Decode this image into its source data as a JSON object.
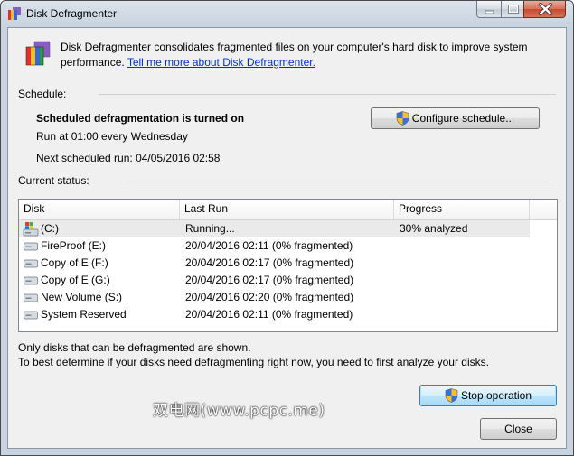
{
  "window": {
    "title": "Disk Defragmenter"
  },
  "intro": {
    "text": "Disk Defragmenter consolidates fragmented files on your computer's hard disk to improve system performance.",
    "link": "Tell me more about Disk Defragmenter."
  },
  "schedule": {
    "label": "Schedule:",
    "status": "Scheduled defragmentation is turned on",
    "run_at": "Run at 01:00 every Wednesday",
    "next_run": "Next scheduled run: 04/05/2016 02:58",
    "configure_button": "Configure schedule..."
  },
  "current_status": {
    "label": "Current status:",
    "columns": [
      "Disk",
      "Last Run",
      "Progress"
    ],
    "rows": [
      {
        "disk": "(C:)",
        "last_run": "Running...",
        "progress": "30% analyzed",
        "icon": "system-drive-icon"
      },
      {
        "disk": "FireProof (E:)",
        "last_run": "20/04/2016 02:11 (0% fragmented)",
        "progress": "",
        "icon": "drive-icon"
      },
      {
        "disk": "Copy of E (F:)",
        "last_run": "20/04/2016 02:17 (0% fragmented)",
        "progress": "",
        "icon": "drive-icon"
      },
      {
        "disk": "Copy of E (G:)",
        "last_run": "20/04/2016 02:17 (0% fragmented)",
        "progress": "",
        "icon": "drive-icon"
      },
      {
        "disk": "New Volume (S:)",
        "last_run": "20/04/2016 02:20 (0% fragmented)",
        "progress": "",
        "icon": "drive-icon"
      },
      {
        "disk": "System Reserved",
        "last_run": "20/04/2016 02:11 (0% fragmented)",
        "progress": "",
        "icon": "drive-icon"
      }
    ]
  },
  "notes": {
    "line1": "Only disks that can be defragmented are shown.",
    "line2": "To best determine if your disks need defragmenting right now, you need to first analyze your disks."
  },
  "buttons": {
    "stop": "Stop operation",
    "close": "Close"
  },
  "watermark": "双电网(www.pcpc.me)"
}
